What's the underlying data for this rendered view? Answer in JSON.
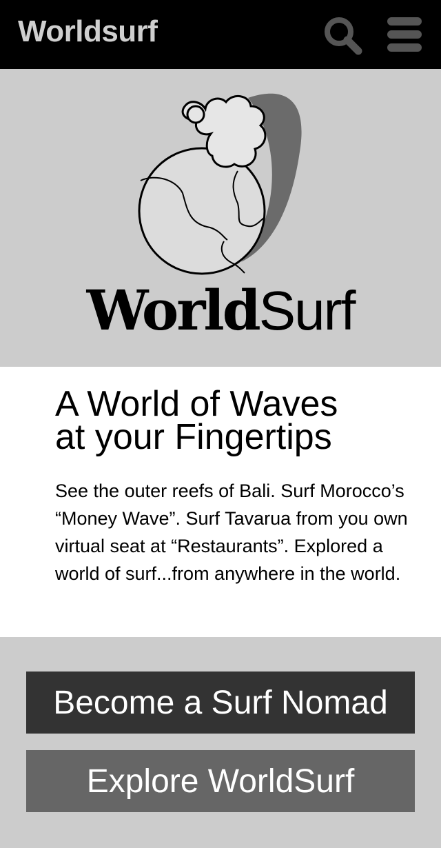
{
  "header": {
    "title": "Worldsurf",
    "search_icon": "search-icon",
    "menu_icon": "hamburger-menu-icon"
  },
  "hero": {
    "logo_icon": "globe-with-wave-logo",
    "logo_word_bold": "World",
    "logo_word_light": "Surf"
  },
  "content": {
    "headline_line1": "A World of Waves",
    "headline_line2": "at your Fingertips",
    "body": "See the outer reefs of Bali. Surf Morocco’s “Money Wave”. Surf Tavarua from you own virtual seat at “Restaurants”. Explored a world of surf...from anywhere in the world."
  },
  "actions": {
    "primary_label": "Become a Surf Nomad",
    "secondary_label": "Explore WorldSurf"
  },
  "colors": {
    "topbar_bg": "#000000",
    "hero_bg": "#cccccc",
    "primary_button": "#333333",
    "secondary_button": "#666666"
  }
}
